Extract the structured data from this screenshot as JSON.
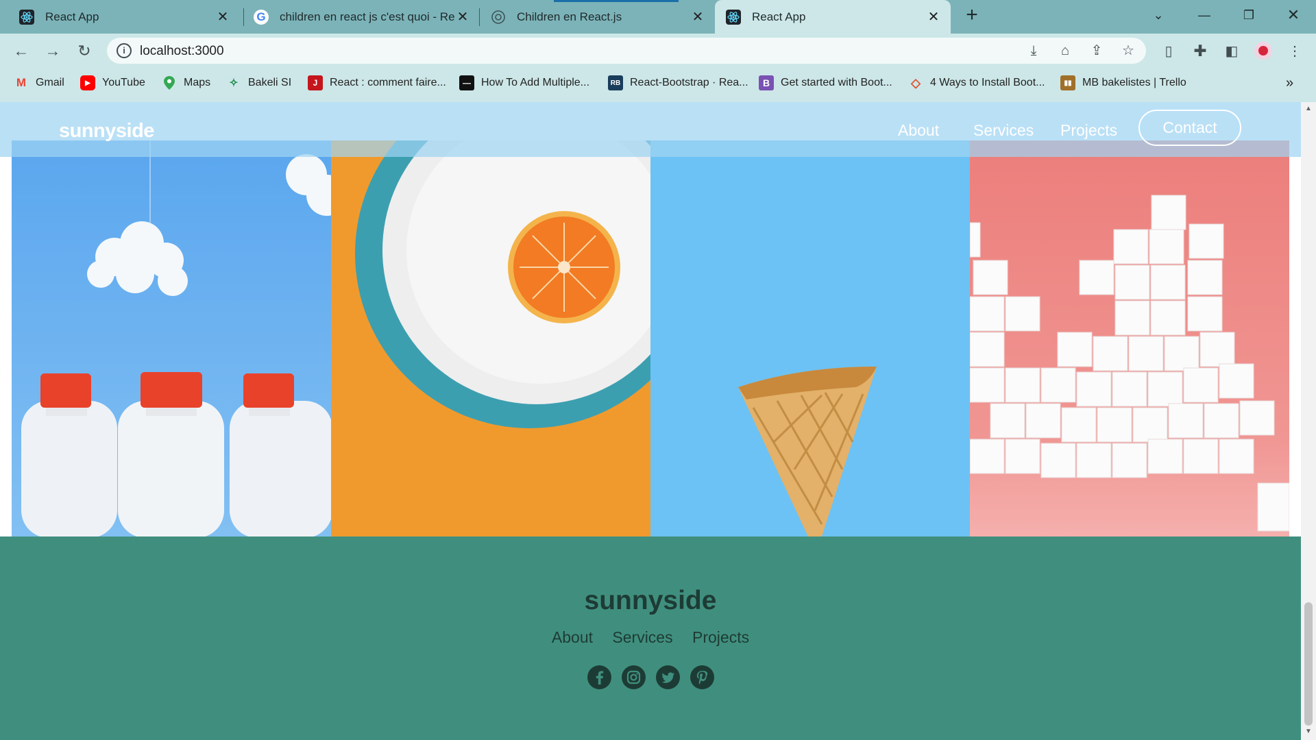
{
  "browser": {
    "tabs": [
      {
        "title": "React App",
        "icon": "react-logo-icon"
      },
      {
        "title": "children en react js c'est quoi - Rech",
        "icon": "google-icon"
      },
      {
        "title": "Children en React.js",
        "icon": "chatgpt-icon"
      },
      {
        "title": "React App",
        "icon": "react-logo-icon",
        "active": true
      }
    ],
    "new_tab_symbol": "+",
    "url": "localhost:3000",
    "bookmarks": [
      {
        "label": "Gmail",
        "icon": "gmail-icon",
        "color": "#ea4335"
      },
      {
        "label": "YouTube",
        "icon": "youtube-icon",
        "color": "#ff0000"
      },
      {
        "label": "Maps",
        "icon": "maps-pin-icon",
        "color": "#34a853"
      },
      {
        "label": "Bakeli SI",
        "icon": "bakeli-icon",
        "color": "#f2a900"
      },
      {
        "label": "React : comment faire...",
        "icon": "j-logo-icon",
        "color": "#c4161c"
      },
      {
        "label": "How To Add Multiple...",
        "icon": "site-icon",
        "color": "#111111"
      },
      {
        "label": "React-Bootstrap · Rea...",
        "icon": "react-bootstrap-icon",
        "color": "#1a3d5c"
      },
      {
        "label": "Get started with Boot...",
        "icon": "bootstrap-icon",
        "color": "#7952b3"
      },
      {
        "label": "4 Ways to Install Boot...",
        "icon": "diamond-icon",
        "color": "#e34c26"
      },
      {
        "label": "MB bakelistes | Trello",
        "icon": "trello-icon",
        "color": "#a0702a"
      }
    ],
    "more_bookmarks_symbol": "»"
  },
  "site": {
    "logo": "sunnyside",
    "nav": {
      "about": "About",
      "services": "Services",
      "projects": "Projects",
      "contact": "Contact"
    },
    "gallery": [
      {
        "subject": "milk bottles",
        "bg": "#64aef0"
      },
      {
        "subject": "orange on plate",
        "bg": "#f09a2e"
      },
      {
        "subject": "ice cream cone",
        "bg": "#6cc2f4"
      },
      {
        "subject": "sugar cubes",
        "bg": "#ee8b86"
      }
    ],
    "footer": {
      "logo": "sunnyside",
      "nav": {
        "about": "About",
        "services": "Services",
        "projects": "Projects"
      },
      "social": [
        "facebook-icon",
        "instagram-icon",
        "twitter-icon",
        "pinterest-icon"
      ],
      "bg": "#408f7e"
    }
  }
}
